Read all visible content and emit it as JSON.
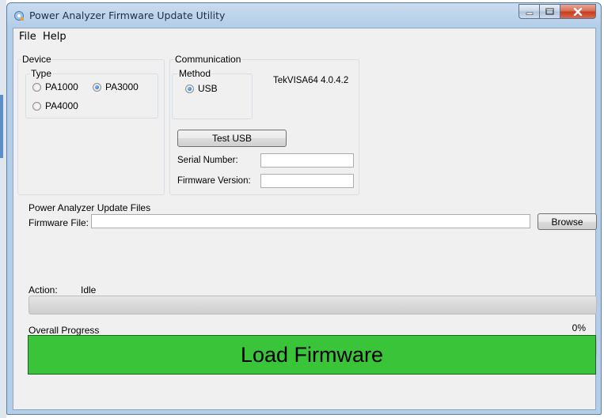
{
  "window": {
    "title": "Power Analyzer Firmware Update Utility"
  },
  "menu": {
    "items": [
      "File",
      "Help"
    ]
  },
  "device": {
    "group_label": "Device",
    "type_label": "Type",
    "options": [
      {
        "label": "PA1000",
        "checked": false
      },
      {
        "label": "PA3000",
        "checked": true
      },
      {
        "label": "PA4000",
        "checked": false
      }
    ]
  },
  "communication": {
    "group_label": "Communication",
    "method_label": "Method",
    "method_option": {
      "label": "USB",
      "checked": true
    },
    "visa_version": "TekVISA64 4.0.4.2",
    "test_button": "Test USB",
    "serial_label": "Serial Number:",
    "serial_value": "",
    "firmware_label": "Firmware Version:",
    "firmware_value": ""
  },
  "update_files": {
    "group_label": "Power Analyzer Update Files",
    "file_label": "Firmware File:",
    "file_value": "",
    "browse_button": "Browse"
  },
  "action": {
    "label": "Action:",
    "value": "Idle",
    "progress": 0
  },
  "overall": {
    "label": "Overall Progress",
    "percent_text": "0%",
    "progress": 0
  },
  "load_button": "Load Firmware",
  "colors": {
    "load_button": "#3ac43a",
    "progress_fill": "#06b025"
  }
}
